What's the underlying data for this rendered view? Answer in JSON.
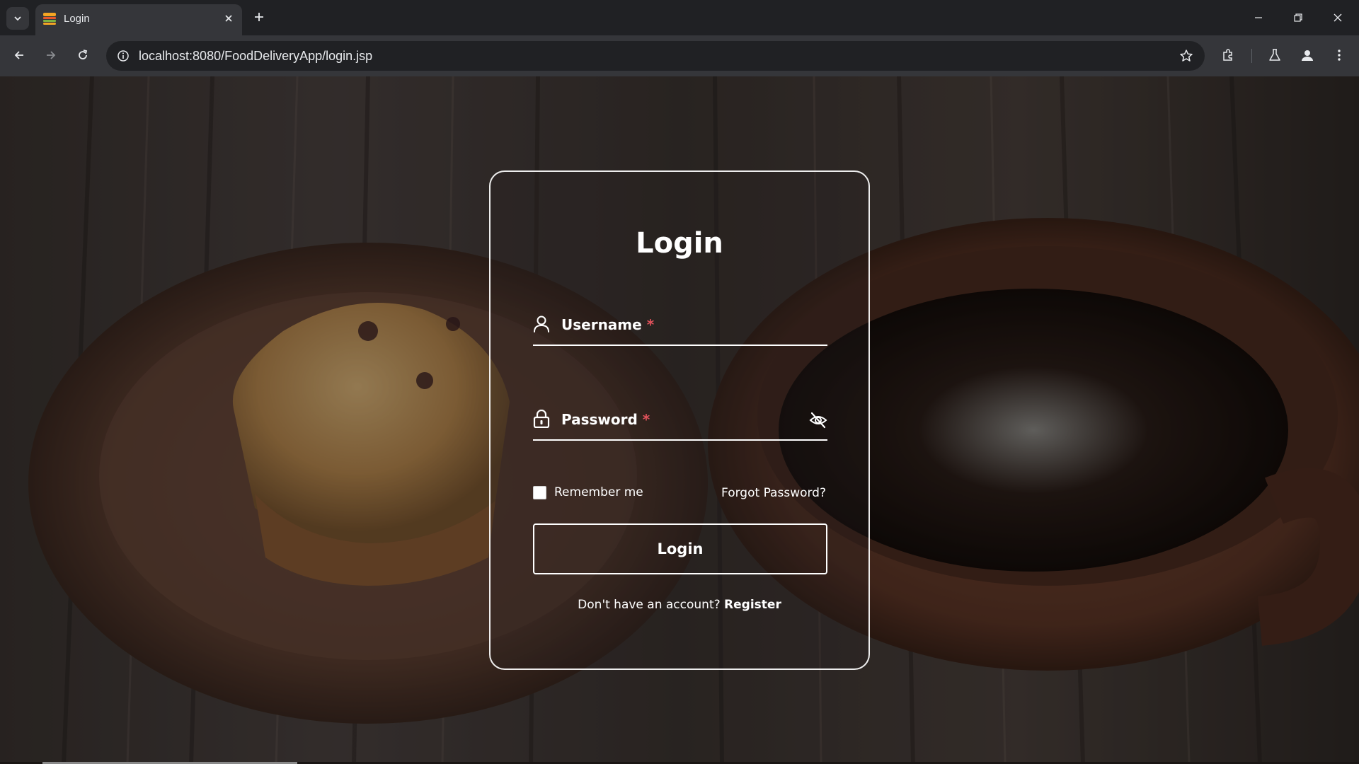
{
  "browser": {
    "tab": {
      "title": "Login"
    },
    "address_bar": {
      "url": "localhost:8080/FoodDeliveryApp/login.jsp"
    }
  },
  "login_card": {
    "title": "Login",
    "username": {
      "label": "Username",
      "required_mark": "*"
    },
    "password": {
      "label": "Password",
      "required_mark": "*"
    },
    "remember_me": {
      "label": "Remember me",
      "checked": false
    },
    "forgot_password": "Forgot Password?",
    "submit_label": "Login",
    "register_prompt": "Don't have an account?",
    "register_link": "Register"
  },
  "icons": {
    "tab_favicon": "food-delivery-icon",
    "username_field": "user-icon",
    "password_field": "lock-icon",
    "password_toggle": "eye-off-icon"
  },
  "colors": {
    "required_asterisk": "#e0525b",
    "card_border": "#ffffff"
  }
}
